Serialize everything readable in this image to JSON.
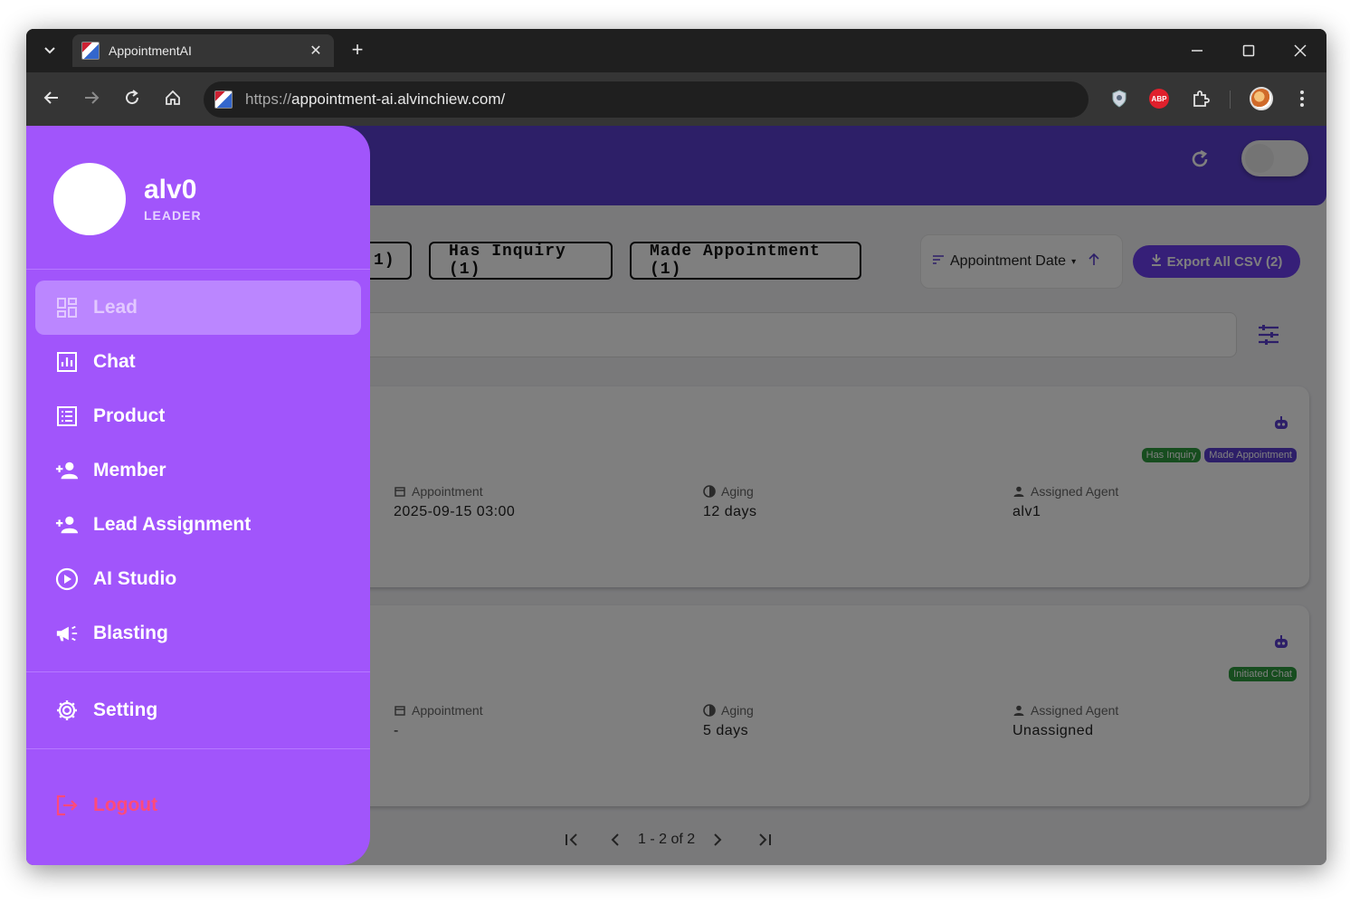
{
  "browser": {
    "tab_title": "AppointmentAI",
    "url_scheme": "https://",
    "url_host": "appointment-ai.alvinchiew.com/",
    "ext_abp_label": "ABP"
  },
  "filters": {
    "chip_partial": "1)",
    "chip_has_inquiry": "Has Inquiry (1)",
    "chip_made_appointment": "Made Appointment (1)",
    "sort_label": "Appointment Date",
    "export_label": "Export All CSV (2)"
  },
  "cards": [
    {
      "tags": [
        {
          "label": "Has Inquiry",
          "color": "#2e9b3e"
        },
        {
          "label": "Made Appointment",
          "color": "#5b3fd1"
        }
      ],
      "appointment_label": "Appointment",
      "appointment_value": "2025-09-15 03:00",
      "aging_label": "Aging",
      "aging_value": "12 days",
      "agent_label": "Assigned Agent",
      "agent_value": "alv1"
    },
    {
      "tags": [
        {
          "label": "Initiated Chat",
          "color": "#2e9b3e"
        }
      ],
      "appointment_label": "Appointment",
      "appointment_value": "-",
      "aging_label": "Aging",
      "aging_value": "5 days",
      "agent_label": "Assigned Agent",
      "agent_value": "Unassigned"
    }
  ],
  "pagination": {
    "range": "1 - 2 of 2"
  },
  "drawer": {
    "user_name": "alv0",
    "user_role": "LEADER",
    "items": [
      {
        "label": "Lead",
        "icon": "dashboard-icon"
      },
      {
        "label": "Chat",
        "icon": "chart-icon"
      },
      {
        "label": "Product",
        "icon": "list-icon"
      },
      {
        "label": "Member",
        "icon": "person-add-icon"
      },
      {
        "label": "Lead Assignment",
        "icon": "person-add-icon"
      },
      {
        "label": "AI Studio",
        "icon": "play-circle-icon"
      },
      {
        "label": "Blasting",
        "icon": "megaphone-icon"
      }
    ],
    "setting_label": "Setting",
    "logout_label": "Logout"
  },
  "colors": {
    "header": "#5b3fd1",
    "drawer": "#a155fb",
    "drawer_active": "#bb86ff",
    "logout": "#ff4a7a"
  }
}
